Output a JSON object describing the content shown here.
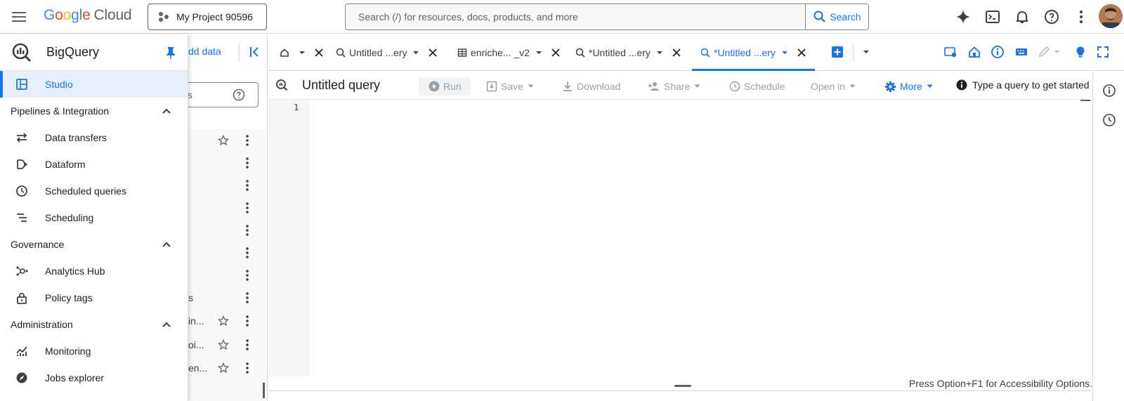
{
  "topbar": {
    "logo_google": "Google",
    "logo_cloud": "Cloud",
    "project_label": "My Project 90596",
    "search_placeholder": "Search (/) for resources, docs, products, and more",
    "search_button": "Search"
  },
  "drawer": {
    "title": "BigQuery",
    "studio": "Studio",
    "sections": [
      {
        "label": "Pipelines & Integration",
        "items": [
          "Data transfers",
          "Dataform",
          "Scheduled queries",
          "Scheduling"
        ]
      },
      {
        "label": "Governance",
        "items": [
          "Analytics Hub",
          "Policy tags"
        ]
      },
      {
        "label": "Administration",
        "items": [
          "Monitoring",
          "Jobs explorer"
        ]
      }
    ]
  },
  "explorer": {
    "add_data": "Add data",
    "add_data_visible": "dd data",
    "search_fragment": "es",
    "row_fragments": [
      "s",
      "in...",
      "oi...",
      "en..."
    ]
  },
  "tabs": [
    {
      "label": "Untitled ...ery",
      "type": "query"
    },
    {
      "label": "enriche... _v2",
      "type": "table"
    },
    {
      "label": "*Untitled ...ery",
      "type": "query"
    },
    {
      "label": "*Untitled ...ery",
      "type": "query",
      "active": true
    }
  ],
  "toolbar": {
    "query_title": "Untitled query",
    "run": "Run",
    "save": "Save",
    "download": "Download",
    "share": "Share",
    "schedule": "Schedule",
    "open_in": "Open in",
    "more": "More",
    "hint": "Type a query to get started"
  },
  "editor": {
    "line_number": "1",
    "a11y": "Press Option+F1 for Accessibility Options."
  },
  "colors": {
    "accent": "#1a73e8",
    "active_bg": "#e8f0fe",
    "disabled_text": "#9aa0a6"
  }
}
